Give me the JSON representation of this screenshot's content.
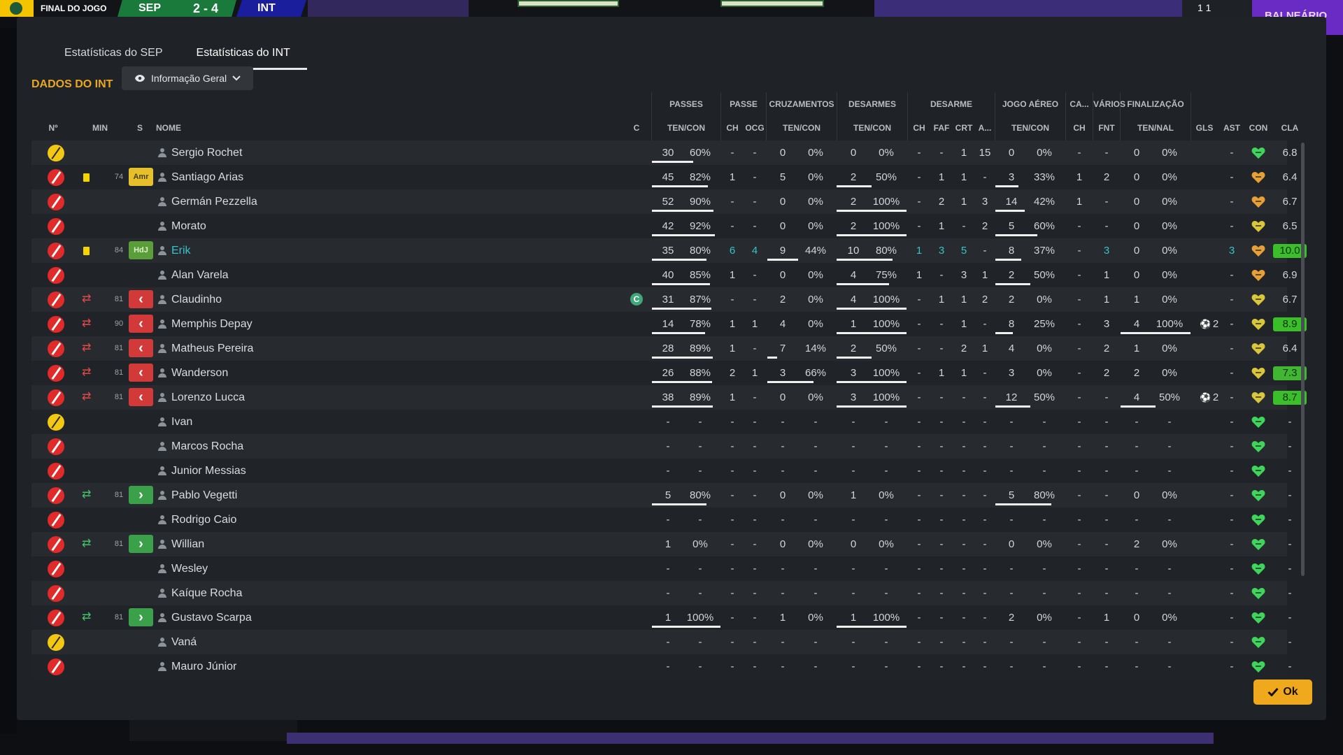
{
  "topbar": {
    "status": "FINAL DO JOGO",
    "home_abbr": "SEP",
    "score": "2 - 4",
    "away_abbr": "INT",
    "right_score": "1 1",
    "dressing_room": "BALNEÁRIO"
  },
  "tabs": [
    {
      "label": "Estatísticas do SEP",
      "active": false
    },
    {
      "label": "Estatísticas do INT",
      "active": true
    }
  ],
  "section_title": "DADOS DO INT",
  "view_dropdown": "Informação Geral",
  "groups": [
    "PASSES",
    "PASSE",
    "CRUZAMENTOS",
    "DESARMES",
    "DESARME",
    "JOGO AÉREO",
    "CA...",
    "VÁRIOS",
    "FINALIZAÇÃO"
  ],
  "headers": {
    "no": "Nº",
    "min": "MIN",
    "s": "S",
    "name": "NOME",
    "c": "C",
    "passes": "TEN/CON",
    "passe_ch": "CH",
    "passe_ocg": "OCG",
    "cruz": "TEN/CON",
    "desarmes": "TEN/CON",
    "des_ch": "CH",
    "des_faf": "FAF",
    "des_crt": "CRT",
    "des_a": "A...",
    "aereo": "TEN/CON",
    "ca_ch": "CH",
    "var_fnt": "FNT",
    "fin": "TEN/NAL",
    "gls": "GLS",
    "ast": "AST",
    "con": "CON",
    "cla": "CLA"
  },
  "rows": [
    {
      "name": "Sergio Rochet",
      "gk": true,
      "card": false,
      "min": "",
      "s": "",
      "cap": false,
      "p": [
        "30",
        "60%"
      ],
      "ch": "-",
      "ocg": "-",
      "cr": [
        "0",
        "0%"
      ],
      "de": [
        "0",
        "0%"
      ],
      "dch": "-",
      "faf": "-",
      "crt": "1",
      "a": "15",
      "ae": [
        "0",
        "0%"
      ],
      "cach": "-",
      "fnt": "-",
      "fin": [
        "0",
        "0%"
      ],
      "gls": "",
      "ast": "-",
      "cla": "6.8",
      "pf": 0.6,
      "cf": 0,
      "df": 0,
      "af": 0,
      "ff": 0,
      "hl": false,
      "heart": "green"
    },
    {
      "name": "Santiago Arias",
      "gk": false,
      "card": true,
      "min": "74",
      "s": "Amr",
      "cap": false,
      "p": [
        "45",
        "82%"
      ],
      "ch": "1",
      "ocg": "-",
      "cr": [
        "5",
        "0%"
      ],
      "de": [
        "2",
        "50%"
      ],
      "dch": "-",
      "faf": "1",
      "crt": "1",
      "a": "-",
      "ae": [
        "3",
        "33%"
      ],
      "cach": "1",
      "fnt": "2",
      "fin": [
        "0",
        "0%"
      ],
      "gls": "",
      "ast": "-",
      "cla": "6.4",
      "pf": 0.82,
      "cf": 0,
      "df": 0.5,
      "af": 0.33,
      "ff": 0,
      "hl": false,
      "heart": "orange"
    },
    {
      "name": "Germán Pezzella",
      "gk": false,
      "card": false,
      "min": "",
      "s": "",
      "cap": false,
      "p": [
        "52",
        "90%"
      ],
      "ch": "-",
      "ocg": "-",
      "cr": [
        "0",
        "0%"
      ],
      "de": [
        "2",
        "100%"
      ],
      "dch": "-",
      "faf": "2",
      "crt": "1",
      "a": "3",
      "ae": [
        "14",
        "42%"
      ],
      "cach": "1",
      "fnt": "-",
      "fin": [
        "0",
        "0%"
      ],
      "gls": "",
      "ast": "-",
      "cla": "6.7",
      "pf": 0.9,
      "cf": 0,
      "df": 1,
      "af": 0.42,
      "ff": 0,
      "hl": false,
      "heart": "orange"
    },
    {
      "name": "Morato",
      "gk": false,
      "card": false,
      "min": "",
      "s": "",
      "cap": false,
      "p": [
        "42",
        "92%"
      ],
      "ch": "-",
      "ocg": "-",
      "cr": [
        "0",
        "0%"
      ],
      "de": [
        "2",
        "100%"
      ],
      "dch": "-",
      "faf": "1",
      "crt": "-",
      "a": "2",
      "ae": [
        "5",
        "60%"
      ],
      "cach": "-",
      "fnt": "-",
      "fin": [
        "0",
        "0%"
      ],
      "gls": "",
      "ast": "-",
      "cla": "6.5",
      "pf": 0.92,
      "cf": 0,
      "df": 1,
      "af": 0.6,
      "ff": 0,
      "hl": false,
      "heart": "yellow"
    },
    {
      "name": "Erik",
      "gk": false,
      "card": true,
      "min": "84",
      "s": "HdJ",
      "cap": false,
      "p": [
        "35",
        "80%"
      ],
      "ch": "6",
      "ocg": "4",
      "cr": [
        "9",
        "44%"
      ],
      "de": [
        "10",
        "80%"
      ],
      "dch": "1",
      "faf": "3",
      "crt": "5",
      "a": "-",
      "ae": [
        "8",
        "37%"
      ],
      "cach": "-",
      "fnt": "3",
      "fin": [
        "0",
        "0%"
      ],
      "gls": "",
      "ast": "3",
      "cla": "10.0",
      "pf": 0.8,
      "cf": 0.44,
      "df": 0.8,
      "af": 0.37,
      "ff": 0,
      "hl": true,
      "heart": "orange"
    },
    {
      "name": "Alan Varela",
      "gk": false,
      "card": false,
      "min": "",
      "s": "",
      "cap": false,
      "p": [
        "40",
        "85%"
      ],
      "ch": "1",
      "ocg": "-",
      "cr": [
        "0",
        "0%"
      ],
      "de": [
        "4",
        "75%"
      ],
      "dch": "1",
      "faf": "-",
      "crt": "3",
      "a": "1",
      "ae": [
        "2",
        "50%"
      ],
      "cach": "-",
      "fnt": "1",
      "fin": [
        "0",
        "0%"
      ],
      "gls": "",
      "ast": "-",
      "cla": "6.9",
      "pf": 0.85,
      "cf": 0,
      "df": 0.75,
      "af": 0.5,
      "ff": 0,
      "hl": false,
      "heart": "orange"
    },
    {
      "name": "Claudinho",
      "gk": false,
      "card": false,
      "min": "81",
      "s": "out",
      "cap": true,
      "captain_letter": "C",
      "p": [
        "31",
        "87%"
      ],
      "ch": "-",
      "ocg": "-",
      "cr": [
        "2",
        "0%"
      ],
      "de": [
        "4",
        "100%"
      ],
      "dch": "-",
      "faf": "1",
      "crt": "1",
      "a": "2",
      "ae": [
        "2",
        "0%"
      ],
      "cach": "-",
      "fnt": "1",
      "fin": [
        "1",
        "0%"
      ],
      "gls": "",
      "ast": "-",
      "cla": "6.7",
      "pf": 0.87,
      "cf": 0,
      "df": 1,
      "af": 0,
      "ff": 0,
      "hl": false,
      "heart": "yellow"
    },
    {
      "name": "Memphis Depay",
      "gk": false,
      "card": false,
      "min": "90",
      "s": "out",
      "cap": false,
      "p": [
        "14",
        "78%"
      ],
      "ch": "1",
      "ocg": "1",
      "cr": [
        "4",
        "0%"
      ],
      "de": [
        "1",
        "100%"
      ],
      "dch": "-",
      "faf": "-",
      "crt": "1",
      "a": "-",
      "ae": [
        "8",
        "25%"
      ],
      "cach": "-",
      "fnt": "3",
      "fin": [
        "4",
        "100%"
      ],
      "gls": "2",
      "ast": "-",
      "cla": "8.9",
      "pf": 0.78,
      "cf": 0,
      "df": 1,
      "af": 0.25,
      "ff": 1,
      "hl": false,
      "heart": "yellow"
    },
    {
      "name": "Matheus Pereira",
      "gk": false,
      "card": false,
      "min": "81",
      "s": "out",
      "cap": false,
      "p": [
        "28",
        "89%"
      ],
      "ch": "1",
      "ocg": "-",
      "cr": [
        "7",
        "14%"
      ],
      "de": [
        "2",
        "50%"
      ],
      "dch": "-",
      "faf": "-",
      "crt": "2",
      "a": "1",
      "ae": [
        "4",
        "0%"
      ],
      "cach": "-",
      "fnt": "2",
      "fin": [
        "1",
        "0%"
      ],
      "gls": "",
      "ast": "-",
      "cla": "6.4",
      "pf": 0.89,
      "cf": 0.14,
      "df": 0.5,
      "af": 0,
      "ff": 0,
      "hl": false,
      "heart": "yellow"
    },
    {
      "name": "Wanderson",
      "gk": false,
      "card": false,
      "min": "81",
      "s": "out",
      "cap": false,
      "p": [
        "26",
        "88%"
      ],
      "ch": "2",
      "ocg": "1",
      "cr": [
        "3",
        "66%"
      ],
      "de": [
        "3",
        "100%"
      ],
      "dch": "-",
      "faf": "1",
      "crt": "1",
      "a": "-",
      "ae": [
        "3",
        "0%"
      ],
      "cach": "-",
      "fnt": "2",
      "fin": [
        "2",
        "0%"
      ],
      "gls": "",
      "ast": "-",
      "cla": "7.3",
      "pf": 0.88,
      "cf": 0.66,
      "df": 1,
      "af": 0,
      "ff": 0,
      "hl": false,
      "heart": "yellow"
    },
    {
      "name": "Lorenzo Lucca",
      "gk": false,
      "card": false,
      "min": "81",
      "s": "out",
      "cap": false,
      "p": [
        "38",
        "89%"
      ],
      "ch": "1",
      "ocg": "-",
      "cr": [
        "0",
        "0%"
      ],
      "de": [
        "3",
        "100%"
      ],
      "dch": "-",
      "faf": "-",
      "crt": "-",
      "a": "-",
      "ae": [
        "12",
        "50%"
      ],
      "cach": "-",
      "fnt": "-",
      "fin": [
        "4",
        "50%"
      ],
      "gls": "2",
      "ast": "-",
      "cla": "8.7",
      "pf": 0.89,
      "cf": 0,
      "df": 1,
      "af": 0.5,
      "ff": 0.5,
      "hl": false,
      "heart": "yellow"
    },
    {
      "name": "Ivan",
      "gk": true,
      "card": false,
      "min": "",
      "s": "",
      "cap": false,
      "p": [
        "-",
        "-"
      ],
      "ch": "-",
      "ocg": "-",
      "cr": [
        "-",
        "-"
      ],
      "de": [
        "-",
        "-"
      ],
      "dch": "-",
      "faf": "-",
      "crt": "-",
      "a": "-",
      "ae": [
        "-",
        "-"
      ],
      "cach": "-",
      "fnt": "-",
      "fin": [
        "-",
        "-"
      ],
      "gls": "",
      "ast": "-",
      "cla": "-",
      "pf": 0,
      "cf": 0,
      "df": 0,
      "af": 0,
      "ff": 0,
      "hl": false,
      "heart": "green"
    },
    {
      "name": "Marcos Rocha",
      "gk": false,
      "card": false,
      "min": "",
      "s": "",
      "cap": false,
      "p": [
        "-",
        "-"
      ],
      "ch": "-",
      "ocg": "-",
      "cr": [
        "-",
        "-"
      ],
      "de": [
        "-",
        "-"
      ],
      "dch": "-",
      "faf": "-",
      "crt": "-",
      "a": "-",
      "ae": [
        "-",
        "-"
      ],
      "cach": "-",
      "fnt": "-",
      "fin": [
        "-",
        "-"
      ],
      "gls": "",
      "ast": "-",
      "cla": "-",
      "pf": 0,
      "cf": 0,
      "df": 0,
      "af": 0,
      "ff": 0,
      "hl": false,
      "heart": "green"
    },
    {
      "name": "Junior Messias",
      "gk": false,
      "card": false,
      "min": "",
      "s": "",
      "cap": false,
      "p": [
        "-",
        "-"
      ],
      "ch": "-",
      "ocg": "-",
      "cr": [
        "-",
        "-"
      ],
      "de": [
        "-",
        "-"
      ],
      "dch": "-",
      "faf": "-",
      "crt": "-",
      "a": "-",
      "ae": [
        "-",
        "-"
      ],
      "cach": "-",
      "fnt": "-",
      "fin": [
        "-",
        "-"
      ],
      "gls": "",
      "ast": "-",
      "cla": "-",
      "pf": 0,
      "cf": 0,
      "df": 0,
      "af": 0,
      "ff": 0,
      "hl": false,
      "heart": "green"
    },
    {
      "name": "Pablo Vegetti",
      "gk": false,
      "card": false,
      "min": "81",
      "s": "in",
      "cap": false,
      "p": [
        "5",
        "80%"
      ],
      "ch": "-",
      "ocg": "-",
      "cr": [
        "0",
        "0%"
      ],
      "de": [
        "1",
        "0%"
      ],
      "dch": "-",
      "faf": "-",
      "crt": "-",
      "a": "-",
      "ae": [
        "5",
        "80%"
      ],
      "cach": "-",
      "fnt": "-",
      "fin": [
        "0",
        "0%"
      ],
      "gls": "",
      "ast": "-",
      "cla": "-",
      "pf": 0.8,
      "cf": 0,
      "df": 0,
      "af": 0.8,
      "ff": 0,
      "hl": false,
      "heart": "green"
    },
    {
      "name": "Rodrigo Caio",
      "gk": false,
      "card": false,
      "min": "",
      "s": "",
      "cap": false,
      "p": [
        "-",
        "-"
      ],
      "ch": "-",
      "ocg": "-",
      "cr": [
        "-",
        "-"
      ],
      "de": [
        "-",
        "-"
      ],
      "dch": "-",
      "faf": "-",
      "crt": "-",
      "a": "-",
      "ae": [
        "-",
        "-"
      ],
      "cach": "-",
      "fnt": "-",
      "fin": [
        "-",
        "-"
      ],
      "gls": "",
      "ast": "-",
      "cla": "-",
      "pf": 0,
      "cf": 0,
      "df": 0,
      "af": 0,
      "ff": 0,
      "hl": false,
      "heart": "green"
    },
    {
      "name": "Willian",
      "gk": false,
      "card": false,
      "min": "81",
      "s": "in",
      "cap": false,
      "p": [
        "1",
        "0%"
      ],
      "ch": "-",
      "ocg": "-",
      "cr": [
        "0",
        "0%"
      ],
      "de": [
        "0",
        "0%"
      ],
      "dch": "-",
      "faf": "-",
      "crt": "-",
      "a": "-",
      "ae": [
        "0",
        "0%"
      ],
      "cach": "-",
      "fnt": "-",
      "fin": [
        "2",
        "0%"
      ],
      "gls": "",
      "ast": "-",
      "cla": "-",
      "pf": 0,
      "cf": 0,
      "df": 0,
      "af": 0,
      "ff": 0,
      "hl": false,
      "heart": "green"
    },
    {
      "name": "Wesley",
      "gk": false,
      "card": false,
      "min": "",
      "s": "",
      "cap": false,
      "p": [
        "-",
        "-"
      ],
      "ch": "-",
      "ocg": "-",
      "cr": [
        "-",
        "-"
      ],
      "de": [
        "-",
        "-"
      ],
      "dch": "-",
      "faf": "-",
      "crt": "-",
      "a": "-",
      "ae": [
        "-",
        "-"
      ],
      "cach": "-",
      "fnt": "-",
      "fin": [
        "-",
        "-"
      ],
      "gls": "",
      "ast": "-",
      "cla": "-",
      "pf": 0,
      "cf": 0,
      "df": 0,
      "af": 0,
      "ff": 0,
      "hl": false,
      "heart": "green"
    },
    {
      "name": "Kaíque Rocha",
      "gk": false,
      "card": false,
      "min": "",
      "s": "",
      "cap": false,
      "p": [
        "-",
        "-"
      ],
      "ch": "-",
      "ocg": "-",
      "cr": [
        "-",
        "-"
      ],
      "de": [
        "-",
        "-"
      ],
      "dch": "-",
      "faf": "-",
      "crt": "-",
      "a": "-",
      "ae": [
        "-",
        "-"
      ],
      "cach": "-",
      "fnt": "-",
      "fin": [
        "-",
        "-"
      ],
      "gls": "",
      "ast": "-",
      "cla": "-",
      "pf": 0,
      "cf": 0,
      "df": 0,
      "af": 0,
      "ff": 0,
      "hl": false,
      "heart": "green"
    },
    {
      "name": "Gustavo Scarpa",
      "gk": false,
      "card": false,
      "min": "81",
      "s": "in",
      "cap": false,
      "p": [
        "1",
        "100%"
      ],
      "ch": "-",
      "ocg": "-",
      "cr": [
        "1",
        "0%"
      ],
      "de": [
        "1",
        "100%"
      ],
      "dch": "-",
      "faf": "-",
      "crt": "-",
      "a": "-",
      "ae": [
        "2",
        "0%"
      ],
      "cach": "-",
      "fnt": "1",
      "fin": [
        "0",
        "0%"
      ],
      "gls": "",
      "ast": "-",
      "cla": "-",
      "pf": 1,
      "cf": 0,
      "df": 1,
      "af": 0,
      "ff": 0,
      "hl": false,
      "heart": "green"
    },
    {
      "name": "Vaná",
      "gk": true,
      "card": false,
      "min": "",
      "s": "",
      "cap": false,
      "p": [
        "-",
        "-"
      ],
      "ch": "-",
      "ocg": "-",
      "cr": [
        "-",
        "-"
      ],
      "de": [
        "-",
        "-"
      ],
      "dch": "-",
      "faf": "-",
      "crt": "-",
      "a": "-",
      "ae": [
        "-",
        "-"
      ],
      "cach": "-",
      "fnt": "-",
      "fin": [
        "-",
        "-"
      ],
      "gls": "",
      "ast": "-",
      "cla": "-",
      "pf": 0,
      "cf": 0,
      "df": 0,
      "af": 0,
      "ff": 0,
      "hl": false,
      "heart": "green"
    },
    {
      "name": "Mauro Júnior",
      "gk": false,
      "card": false,
      "min": "",
      "s": "",
      "cap": false,
      "p": [
        "-",
        "-"
      ],
      "ch": "-",
      "ocg": "-",
      "cr": [
        "-",
        "-"
      ],
      "de": [
        "-",
        "-"
      ],
      "dch": "-",
      "faf": "-",
      "crt": "-",
      "a": "-",
      "ae": [
        "-",
        "-"
      ],
      "cach": "-",
      "fnt": "-",
      "fin": [
        "-",
        "-"
      ],
      "gls": "",
      "ast": "-",
      "cla": "-",
      "pf": 0,
      "cf": 0,
      "df": 0,
      "af": 0,
      "ff": 0,
      "hl": false,
      "heart": "green"
    }
  ],
  "ok_button": "Ok",
  "colors": {
    "accent": "#e9a81f",
    "ok": "#f0a91d",
    "home": "#1a7a3c",
    "away": "#1b1e9c",
    "highlight": "#36c4c7",
    "heart_green": "#3fd45a",
    "heart_orange": "#e6a035",
    "heart_yellow": "#d9c63a",
    "rating_good": "#41b633"
  }
}
